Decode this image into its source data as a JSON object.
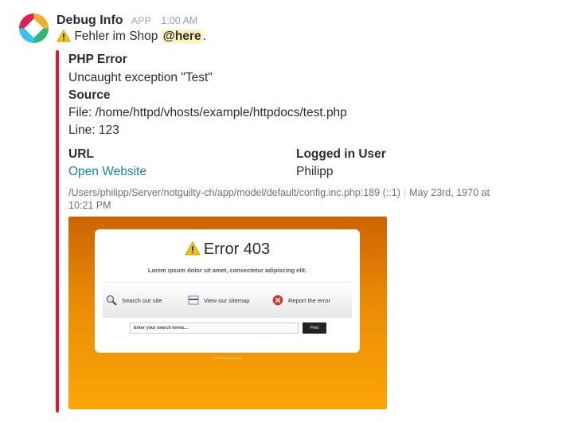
{
  "message": {
    "sender": "Debug Info",
    "badge": "APP",
    "time": "1:00 AM",
    "text_prefix": "Fehler im Shop",
    "mention": "@here",
    "text_suffix": ".",
    "warning_icon": "warning-icon",
    "avatar_colors": [
      "#e01e5a",
      "#ecb22e",
      "#2eb67d",
      "#36c5f0"
    ]
  },
  "attachment": {
    "bar_color": "#e8152a",
    "fields": [
      {
        "title": "PHP Error",
        "value": "Uncaught exception \"Test\""
      },
      {
        "title": "Source",
        "value_lines": [
          "File: /home/httpd/vhosts/example/httpdocs/test.php",
          "Line: 123"
        ]
      },
      {
        "title": "URL",
        "link_text": "Open Website"
      },
      {
        "title": "Logged in User",
        "value": "Philipp"
      }
    ],
    "footer": {
      "path": "/Users/philipp/Server/notguilty-ch/app/model/default/config.inc.php:189 (::1)",
      "separator": "|",
      "date": "May 23rd, 1970 at 10:21 PM"
    },
    "screenshot": {
      "title": "Error 403",
      "subtitle": "Lorem ipsum dolor sit amet, consectetur adipiscing elit.",
      "options": [
        {
          "label": "Search our site",
          "icon": "magnifier-icon"
        },
        {
          "label": "View our sitemap",
          "icon": "sitemap-icon"
        },
        {
          "label": "Report the error",
          "icon": "report-error-icon"
        }
      ],
      "search_text": "Enter your search terms...",
      "find_label": "Find",
      "copyright": "© 2010 your site name"
    }
  }
}
